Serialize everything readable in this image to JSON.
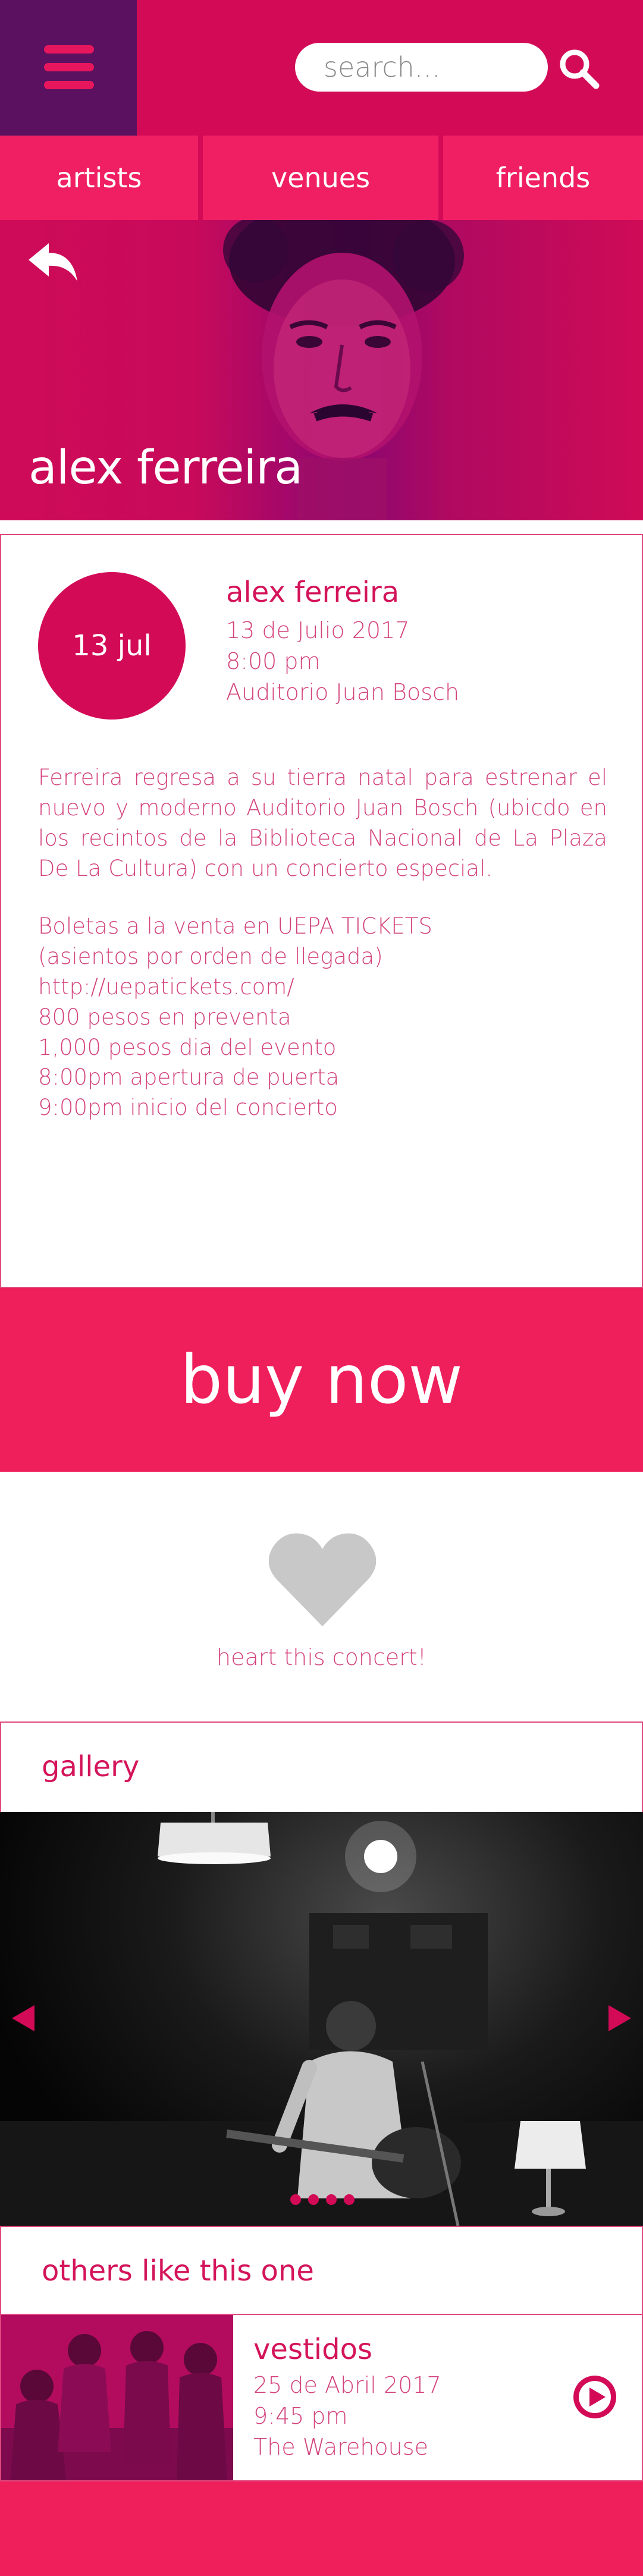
{
  "header": {
    "search_placeholder": "search...",
    "icons": [
      "hamburger-menu-icon",
      "search-icon"
    ]
  },
  "tabs": [
    {
      "label": "artists"
    },
    {
      "label": "venues"
    },
    {
      "label": "friends"
    }
  ],
  "hero": {
    "title": "alex ferreira",
    "back_icon": "back-arrow-icon"
  },
  "event": {
    "badge": "13 jul",
    "name": "alex ferreira",
    "date": "13 de Julio 2017",
    "time": "8:00 pm",
    "venue": "Auditorio Juan Bosch",
    "description": "Ferreira regresa a su tierra natal para estrenar el nuevo y moderno Auditorio Juan Bosch (ubicdo en los recintos de la Biblioteca Nacional de La Plaza De La Cultura) con un concierto especial.",
    "tickets_line1": "Boletas a la venta en UEPA TICKETS",
    "tickets_line2": "(asientos por orden de llegada)",
    "link": "http://uepatickets.com/",
    "presale": "800 pesos en preventa",
    "door_price": "1,000 pesos dia del evento",
    "doors_open": "8:00pm apertura de puerta",
    "concert_start": "9:00pm inicio del concierto"
  },
  "buy": {
    "label": "buy now"
  },
  "heart": {
    "caption": "heart this concert!",
    "icon": "heart-icon"
  },
  "gallery": {
    "title": "gallery",
    "slide_count": 4,
    "active_slide": 1
  },
  "others": {
    "title": "others like this one",
    "items": [
      {
        "name": "vestidos",
        "date": "25 de Abril 2017",
        "time": "9:45 pm",
        "venue": "The Warehouse"
      }
    ]
  },
  "colors": {
    "primary": "#d30b57",
    "accent": "#ef1f5b",
    "menu_bg": "#5b1160",
    "tab_bg": "#f01f63"
  }
}
